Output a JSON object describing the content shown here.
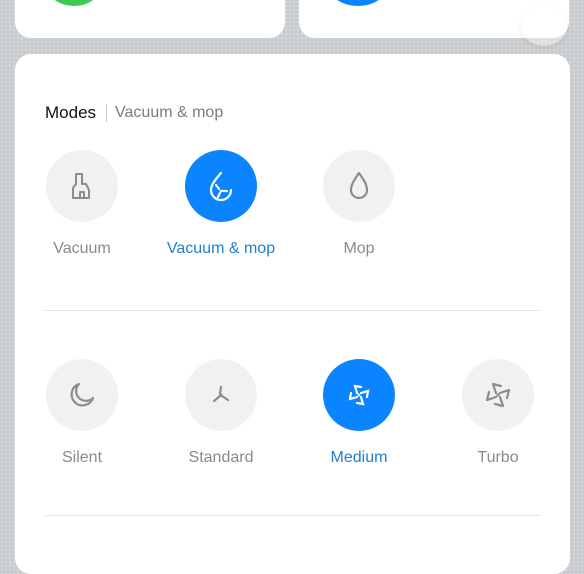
{
  "modes": {
    "title": "Modes",
    "subtitle": "Vacuum & mop",
    "cleaning_modes": [
      {
        "label": "Vacuum",
        "icon": "vacuum-icon",
        "active": false
      },
      {
        "label": "Vacuum & mop",
        "icon": "vacuum-mop-icon",
        "active": true
      },
      {
        "label": "Mop",
        "icon": "water-drop-icon",
        "active": false
      }
    ],
    "suction_levels": [
      {
        "label": "Silent",
        "icon": "moon-icon",
        "active": false
      },
      {
        "label": "Standard",
        "icon": "fan-small-icon",
        "active": false
      },
      {
        "label": "Medium",
        "icon": "fan-medium-icon",
        "active": true
      },
      {
        "label": "Turbo",
        "icon": "fan-large-icon",
        "active": false
      }
    ]
  },
  "colors": {
    "accent": "#0a84ff",
    "active_label": "#1f7fd1",
    "inactive_label": "#8a8a8a",
    "top_left_indicator": "#41c854",
    "top_right_indicator": "#0a84ff"
  }
}
